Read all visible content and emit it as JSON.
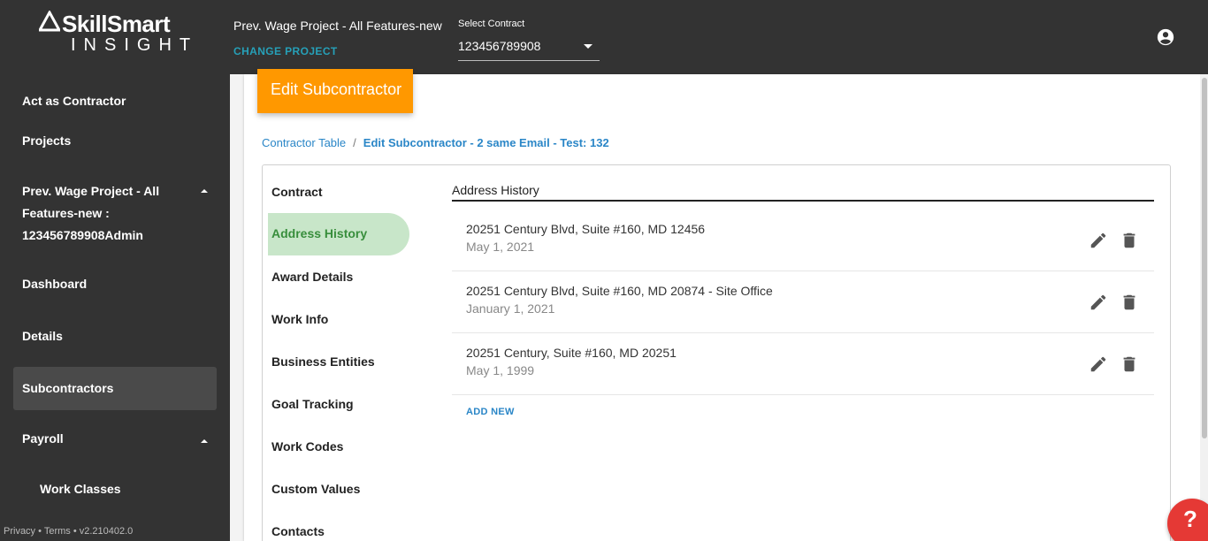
{
  "app": {
    "logo_top": "SkillSmart",
    "logo_bottom": "INSIGHT"
  },
  "header": {
    "project_title": "Prev. Wage Project - All Features-new",
    "change_project": "CHANGE PROJECT",
    "contract_label": "Select Contract",
    "contract_value": "123456789908",
    "account_icon": "account-circle-icon"
  },
  "sidebar": {
    "act_as": "Act as Contractor",
    "projects": "Projects",
    "project_line1": "Prev. Wage Project - All",
    "project_line2": "Features-new :",
    "project_line3": "123456789908Admin",
    "dashboard": "Dashboard",
    "details": "Details",
    "subcontractors": "Subcontractors",
    "payroll": "Payroll",
    "work_classes": "Work Classes",
    "footer_privacy": "Privacy",
    "footer_sep": " • ",
    "footer_terms": "Terms",
    "footer_version": "v2.210402.0"
  },
  "page": {
    "title": "Edit Subcontractor",
    "breadcrumb_root": "Contractor Table",
    "breadcrumb_sep": "/",
    "breadcrumb_current": "Edit Subcontractor - 2 same Email - Test: 132"
  },
  "tabs": {
    "contract": "Contract",
    "address_history": "Address History",
    "award_details": "Award Details",
    "work_info": "Work Info",
    "business_entities": "Business Entities",
    "goal_tracking": "Goal Tracking",
    "work_codes": "Work Codes",
    "custom_values": "Custom Values",
    "contacts": "Contacts"
  },
  "address_history": {
    "title": "Address History",
    "rows": [
      {
        "address": "20251 Century Blvd, Suite #160, MD 12456",
        "date": "May 1, 2021"
      },
      {
        "address": "20251 Century Blvd, Suite #160, MD 20874 - Site Office",
        "date": "January 1, 2021"
      },
      {
        "address": "20251 Century, Suite #160, MD 20251",
        "date": "May 1, 1999"
      }
    ],
    "add_new": "ADD NEW"
  },
  "help": {
    "label": "?"
  },
  "colors": {
    "topbar": "#333333",
    "accent_orange": "#ff9800",
    "link_blue": "#2a86c7",
    "active_tab_bg": "#c8e6c9",
    "active_tab_text": "#388e3c",
    "help_red": "#e53935"
  }
}
